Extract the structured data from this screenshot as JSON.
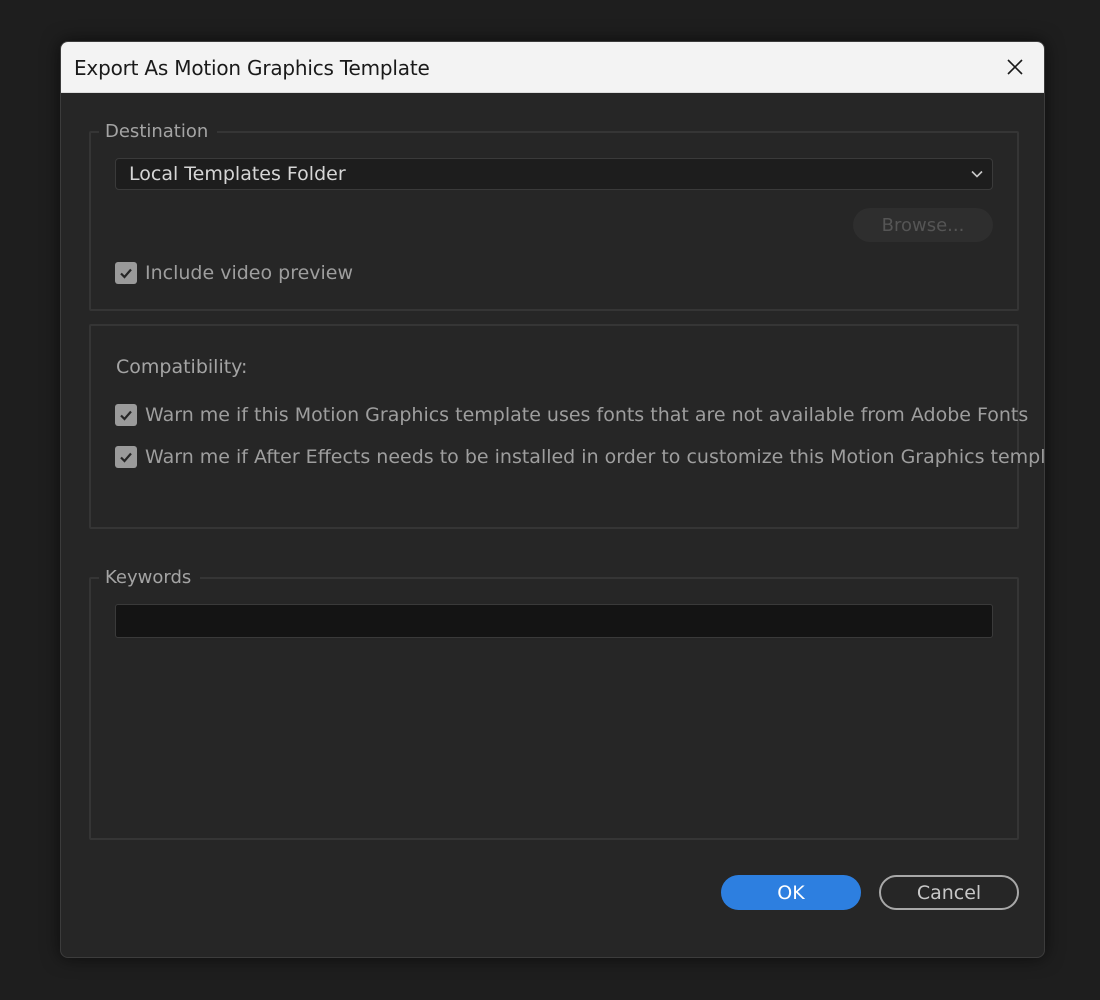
{
  "dialog": {
    "title": "Export As Motion Graphics Template",
    "close_icon": "close-icon"
  },
  "destination": {
    "legend": "Destination",
    "selected": "Local Templates Folder",
    "browse_label": "Browse...",
    "browse_enabled": false,
    "include_preview": {
      "label": "Include video preview",
      "checked": true
    }
  },
  "compatibility": {
    "heading": "Compatibility:",
    "options": [
      {
        "label": "Warn me if this Motion Graphics template uses fonts that are not available from Adobe Fonts",
        "checked": true
      },
      {
        "label": "Warn me if After Effects needs to be installed in order to customize this Motion Graphics template",
        "checked": true
      }
    ]
  },
  "keywords": {
    "legend": "Keywords",
    "value": ""
  },
  "buttons": {
    "ok_label": "OK",
    "cancel_label": "Cancel"
  },
  "colors": {
    "accent": "#2d7fe0",
    "background": "#262626",
    "titlebar": "#f3f3f3"
  }
}
